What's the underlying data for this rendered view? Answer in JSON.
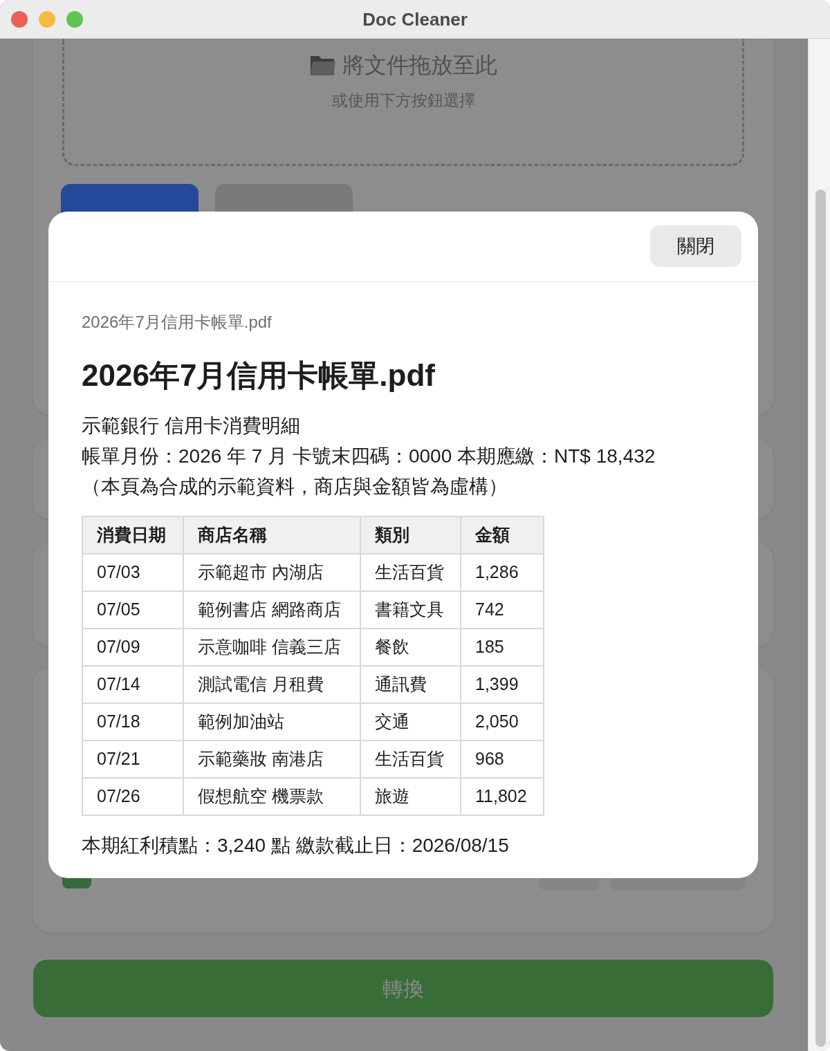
{
  "window": {
    "title": "Doc Cleaner"
  },
  "drop_zone": {
    "title": "將文件拖放至此",
    "hint": "或使用下方按鈕選擇"
  },
  "convert_button": {
    "label": "轉換"
  },
  "modal": {
    "close_button": "關閉",
    "file_name": "2026年7月信用卡帳單.pdf",
    "heading": "2026年7月信用卡帳單.pdf",
    "lines": [
      "示範銀行 信用卡消費明細",
      "帳單月份：2026 年 7 月 卡號末四碼：0000 本期應繳：NT$ 18,432",
      "（本頁為合成的示範資料，商店與金額皆為虛構）"
    ],
    "table": {
      "columns": [
        "消費日期",
        "商店名稱",
        "類別",
        "金額"
      ],
      "rows": [
        [
          "07/03",
          "示範超市 內湖店",
          "生活百貨",
          "1,286"
        ],
        [
          "07/05",
          "範例書店 網路商店",
          "書籍文具",
          "742"
        ],
        [
          "07/09",
          "示意咖啡 信義三店",
          "餐飲",
          "185"
        ],
        [
          "07/14",
          "測試電信 月租費",
          "通訊費",
          "1,399"
        ],
        [
          "07/18",
          "範例加油站",
          "交通",
          "2,050"
        ],
        [
          "07/21",
          "示範藥妝 南港店",
          "生活百貨",
          "968"
        ],
        [
          "07/26",
          "假想航空 機票款",
          "旅遊",
          "11,802"
        ]
      ]
    },
    "footer": "本期紅利積點：3,240 點 繳款截止日：2026/08/15"
  }
}
